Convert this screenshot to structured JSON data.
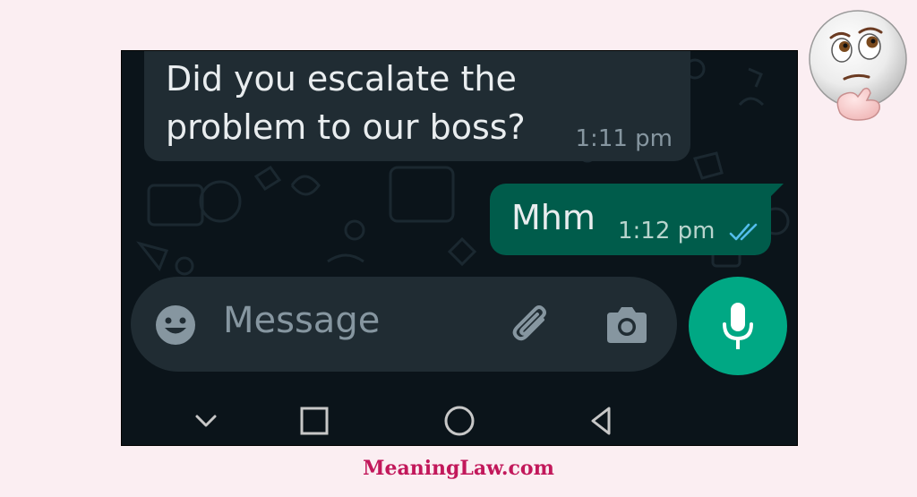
{
  "chat": {
    "incoming": {
      "text": "Did you escalate the problem to our boss?",
      "time": "1:11 pm"
    },
    "outgoing": {
      "text": "Mhm",
      "time": "1:12 pm",
      "status": "double-check-read"
    }
  },
  "composer": {
    "placeholder": "Message",
    "icons": [
      "emoji-icon",
      "attach-icon",
      "camera-icon"
    ]
  },
  "mic_button": {
    "icon": "mic-icon"
  },
  "navigation": {
    "icons": [
      "hide-keyboard-icon",
      "recents-icon",
      "home-icon",
      "back-icon"
    ]
  },
  "footer": {
    "site": "MeaningLaw.com"
  },
  "decoration": {
    "icon": "thinking-face-emoji"
  },
  "colors": {
    "page_background": "#fbeef2",
    "chat_background": "#0b141a",
    "incoming_bubble": "#202c33",
    "outgoing_bubble": "#005c4b",
    "accent": "#00a884",
    "read_ticks": "#53bdeb",
    "footer_text": "#c2185b"
  }
}
